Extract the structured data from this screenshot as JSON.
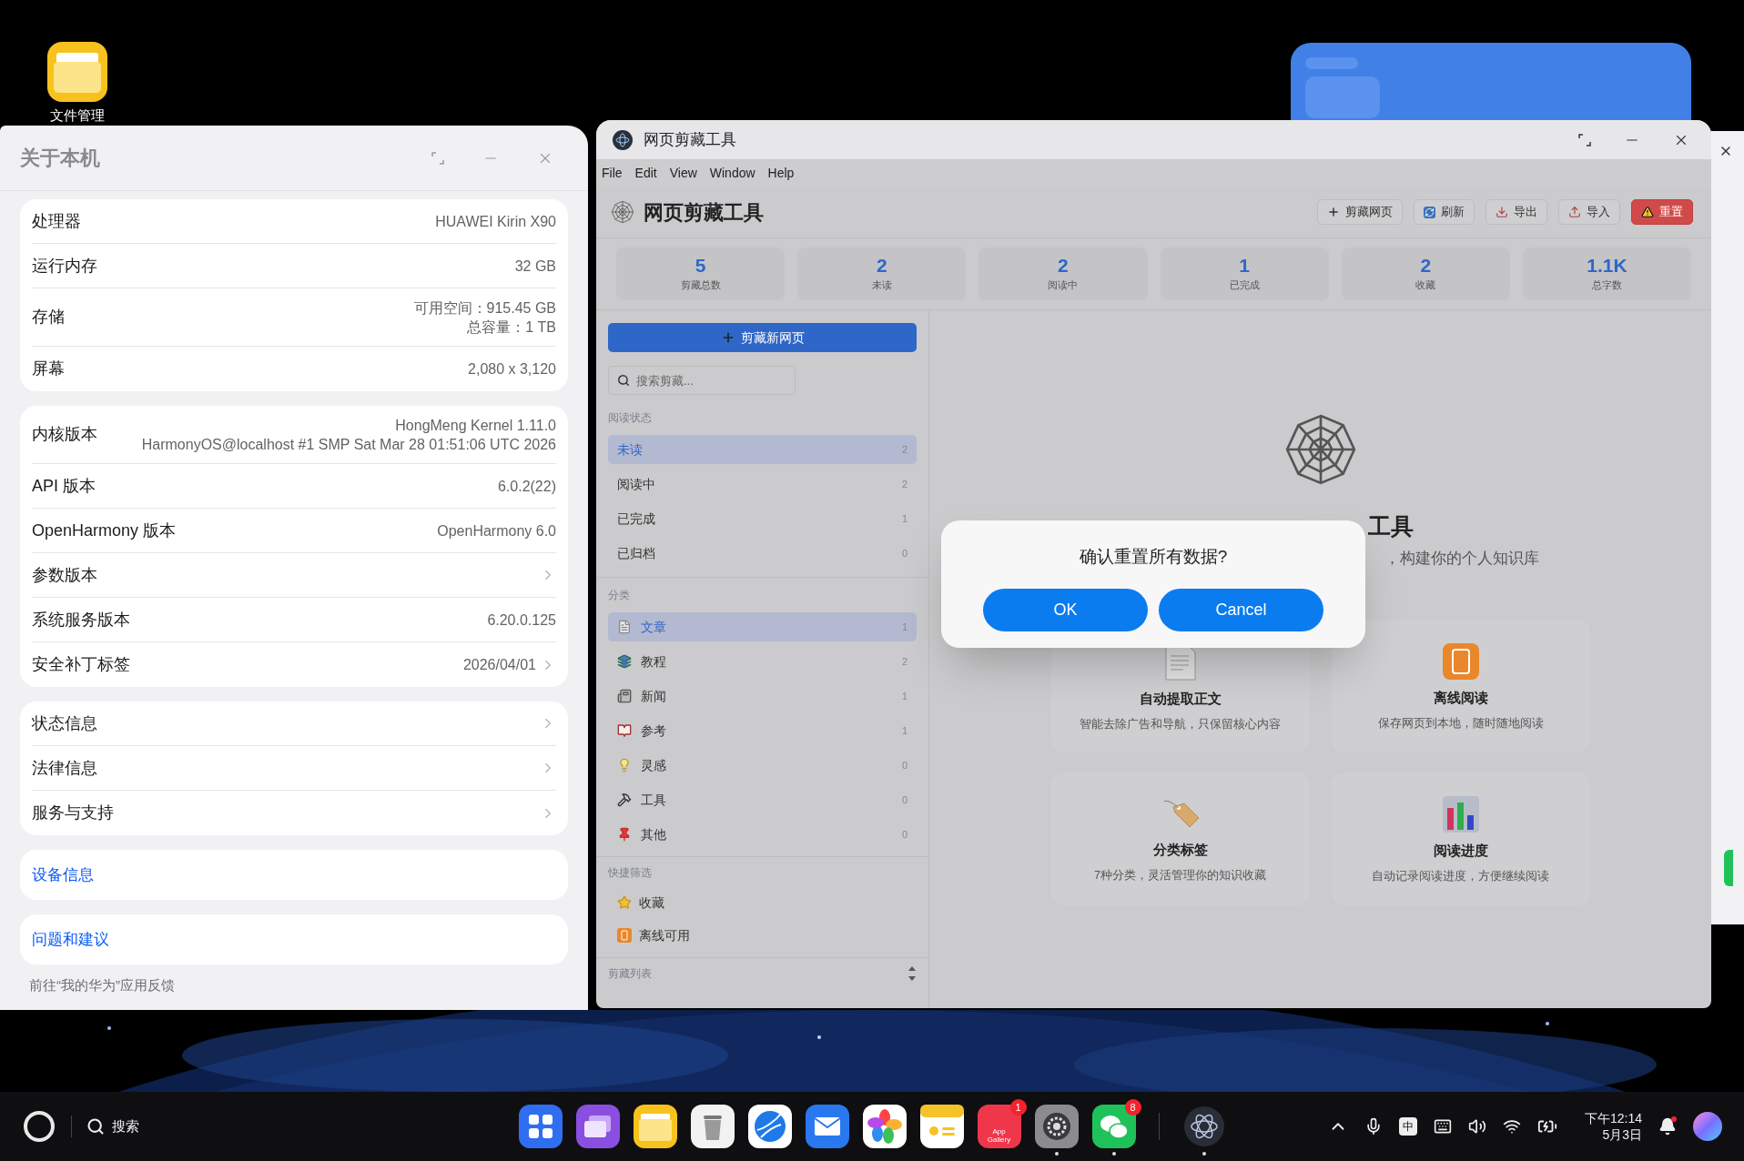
{
  "desktop_icons": [
    {
      "label": "文件管理"
    }
  ],
  "about_window": {
    "title": "关于本机",
    "groups": [
      [
        {
          "label": "处理器",
          "values": [
            "HUAWEI Kirin X90"
          ],
          "chevron": false
        },
        {
          "label": "运行内存",
          "values": [
            "32 GB"
          ],
          "chevron": false
        },
        {
          "label": "存储",
          "values": [
            "可用空间：915.45 GB",
            "总容量：1 TB"
          ],
          "chevron": false
        },
        {
          "label": "屏幕",
          "values": [
            "2,080 x 3,120"
          ],
          "chevron": false
        }
      ],
      [
        {
          "label": "内核版本",
          "values": [
            "HongMeng Kernel 1.11.0",
            "HarmonyOS@localhost #1 SMP Sat Mar 28 01:51:06 UTC 2026"
          ],
          "chevron": false
        },
        {
          "label": "API 版本",
          "values": [
            "6.0.2(22)"
          ],
          "chevron": false
        },
        {
          "label": "OpenHarmony 版本",
          "values": [
            "OpenHarmony 6.0"
          ],
          "chevron": false
        },
        {
          "label": "参数版本",
          "chevron": true
        },
        {
          "label": "系统服务版本",
          "values": [
            "6.20.0.125"
          ],
          "chevron": false
        },
        {
          "label": "安全补丁标签",
          "values": [
            "2026/04/01"
          ],
          "chevron": true
        }
      ],
      [
        {
          "label": "状态信息",
          "chevron": true
        },
        {
          "label": "法律信息",
          "chevron": true
        },
        {
          "label": "服务与支持",
          "chevron": true
        }
      ]
    ],
    "links": [
      {
        "label": "设备信息"
      },
      {
        "label": "问题和建议"
      }
    ],
    "footer": "前往“我的华为”应用反馈"
  },
  "clipper_window": {
    "title": "网页剪藏工具",
    "menu": [
      "File",
      "Edit",
      "View",
      "Window",
      "Help"
    ],
    "app_title": "网页剪藏工具",
    "toolbar": [
      {
        "label": "剪藏网页",
        "kind": "default"
      },
      {
        "label": "刷新",
        "kind": "default"
      },
      {
        "label": "导出",
        "kind": "default"
      },
      {
        "label": "导入",
        "kind": "default"
      },
      {
        "label": "重置",
        "kind": "danger"
      }
    ],
    "stats": [
      {
        "value": "5",
        "label": "剪藏总数"
      },
      {
        "value": "2",
        "label": "未读"
      },
      {
        "value": "2",
        "label": "阅读中"
      },
      {
        "value": "1",
        "label": "已完成"
      },
      {
        "value": "2",
        "label": "收藏"
      },
      {
        "value": "1.1K",
        "label": "总字数"
      }
    ],
    "new_clip_button": "剪藏新网页",
    "search": {
      "placeholder": "搜索剪藏..."
    },
    "reading_status": {
      "heading": "阅读状态",
      "items": [
        {
          "label": "未读",
          "count": "2",
          "selected": true
        },
        {
          "label": "阅读中",
          "count": "2",
          "selected": false
        },
        {
          "label": "已完成",
          "count": "1",
          "selected": false
        },
        {
          "label": "已归档",
          "count": "0",
          "selected": false
        }
      ]
    },
    "categories": {
      "heading": "分类",
      "items": [
        {
          "label": "文章",
          "count": "1",
          "selected": true
        },
        {
          "label": "教程",
          "count": "2",
          "selected": false
        },
        {
          "label": "新闻",
          "count": "1",
          "selected": false
        },
        {
          "label": "参考",
          "count": "1",
          "selected": false
        },
        {
          "label": "灵感",
          "count": "0",
          "selected": false
        },
        {
          "label": "工具",
          "count": "0",
          "selected": false
        },
        {
          "label": "其他",
          "count": "0",
          "selected": false
        }
      ]
    },
    "quick_filters": {
      "heading": "快捷筛选",
      "items": [
        {
          "label": "收藏"
        },
        {
          "label": "离线可用"
        }
      ]
    },
    "clip_list": {
      "heading": "剪藏列表"
    },
    "main": {
      "heading": "工具",
      "subtitle": "，构建你的个人知识库",
      "features": [
        {
          "title": "自动提取正文",
          "desc": "智能去除广告和导航，只保留核心内容"
        },
        {
          "title": "离线阅读",
          "desc": "保存网页到本地，随时随地阅读"
        },
        {
          "title": "分类标签",
          "desc": "7种分类，灵活管理你的知识收藏"
        },
        {
          "title": "阅读进度",
          "desc": "自动记录阅读进度，方便继续阅读"
        }
      ]
    }
  },
  "dialog": {
    "message": "确认重置所有数据?",
    "buttons": [
      {
        "label": "OK"
      },
      {
        "label": "Cancel"
      }
    ]
  },
  "taskbar": {
    "search_label": "搜索",
    "dock": [
      {
        "running": false
      },
      {
        "running": false
      },
      {
        "running": false
      },
      {
        "running": false
      },
      {
        "running": false
      },
      {
        "running": false
      },
      {
        "running": false
      },
      {
        "running": false
      },
      {
        "label": "App Gallery",
        "badge": "1",
        "running": false
      },
      {
        "running": true
      },
      {
        "badge": "8",
        "running": true
      },
      {
        "running": true
      }
    ],
    "ime": "中",
    "clock": {
      "time": "下午12:14",
      "date": "5月3日"
    }
  }
}
